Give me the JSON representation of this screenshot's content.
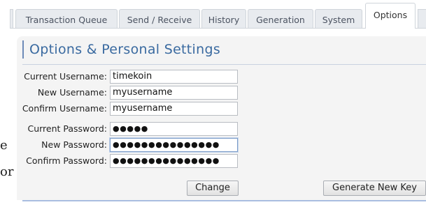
{
  "tabs": [
    {
      "label": "Transaction Queue",
      "active": false
    },
    {
      "label": "Send / Receive",
      "active": false
    },
    {
      "label": "History",
      "active": false
    },
    {
      "label": "Generation",
      "active": false
    },
    {
      "label": "System",
      "active": false
    },
    {
      "label": "Options",
      "active": true
    }
  ],
  "background_fragments": [
    "e",
    "or"
  ],
  "panel": {
    "title": "Options & Personal Settings"
  },
  "username": {
    "current_label": "Current Username:",
    "current_value": "timekoin",
    "new_label": "New Username:",
    "new_value": "myusername",
    "confirm_label": "Confirm Username:",
    "confirm_value": "myusername"
  },
  "password": {
    "current_label": "Current Password:",
    "current_value": "●●●●●",
    "new_label": "New Password:",
    "new_value": "●●●●●●●●●●●●●●●",
    "confirm_label": "Confirm Password:",
    "confirm_value": "●●●●●●●●●●●●●●●"
  },
  "buttons": {
    "change": "Change",
    "generate_key": "Generate New Key"
  },
  "colors": {
    "title_accent": "#3a6aa0",
    "panel_background": "#f4f4f4",
    "tab_background": "#e8ebef"
  }
}
